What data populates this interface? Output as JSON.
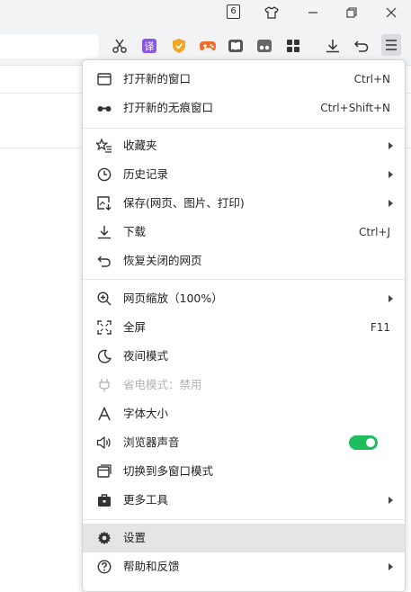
{
  "titlebar": {
    "tab_count": "6"
  },
  "menu": {
    "items": [
      {
        "label": "打开新的窗口",
        "shortcut": "Ctrl+N"
      },
      {
        "label": "打开新的无痕窗口",
        "shortcut": "Ctrl+Shift+N"
      },
      {
        "label": "收藏夹"
      },
      {
        "label": "历史记录"
      },
      {
        "label": "保存(网页、图片、打印)"
      },
      {
        "label": "下载",
        "shortcut": "Ctrl+J"
      },
      {
        "label": "恢复关闭的网页"
      },
      {
        "label": "网页缩放（100%）"
      },
      {
        "label": "全屏",
        "shortcut": "F11"
      },
      {
        "label": "夜间模式"
      },
      {
        "label": "省电模式：禁用"
      },
      {
        "label": "字体大小"
      },
      {
        "label": "浏览器声音"
      },
      {
        "label": "切换到多窗口模式"
      },
      {
        "label": "更多工具"
      },
      {
        "label": "设置"
      },
      {
        "label": "帮助和反馈"
      }
    ],
    "sound_enabled": true,
    "accent_color": "#1ebd5d",
    "hovered_item": "设置"
  }
}
